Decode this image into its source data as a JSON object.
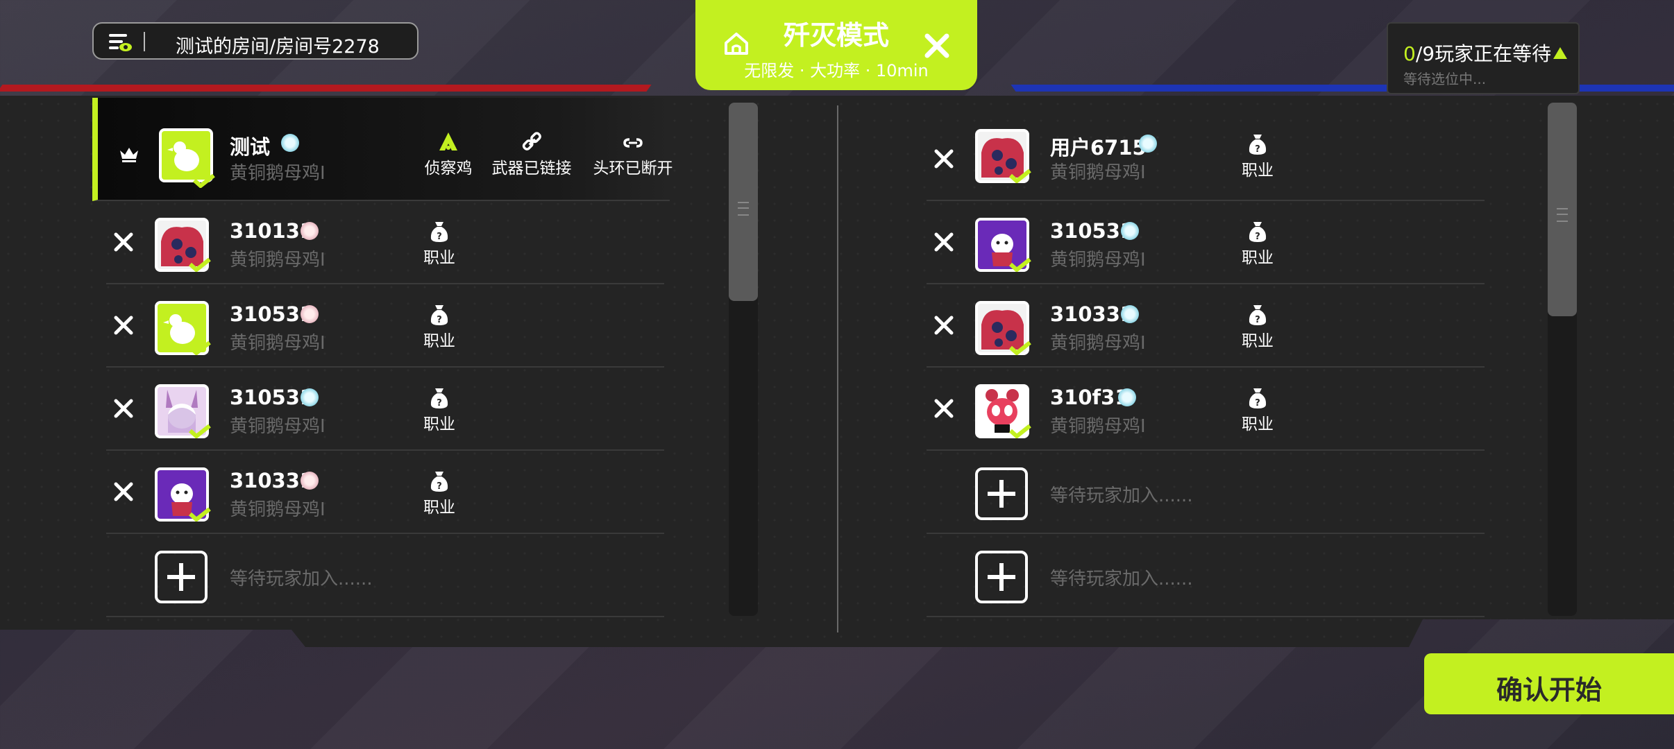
{
  "room": {
    "title": "测试的房间/房间号2278"
  },
  "mode": {
    "title": "歼灭模式",
    "subtitle": "无限发 · 大功率 · 10min"
  },
  "waiting": {
    "count": "0",
    "rest": "/9玩家正在等待",
    "sub": "等待选位中..."
  },
  "role_label": "职业",
  "empty_slot_text": "等待玩家加入......",
  "red_team": {
    "host": {
      "name": "测试",
      "subname": "黄铜鹅母鸡I",
      "role": "侦察鸡",
      "weapon": "武器已链接",
      "headband": "头环已断开"
    },
    "players": [
      {
        "name": "310131",
        "subname": "黄铜鹅母鸡I"
      },
      {
        "name": "310531",
        "subname": "黄铜鹅母鸡I"
      },
      {
        "name": "310531",
        "subname": "黄铜鹅母鸡I"
      },
      {
        "name": "310331",
        "subname": "黄铜鹅母鸡I"
      }
    ]
  },
  "blue_team": {
    "players": [
      {
        "name": "用户6715",
        "subname": "黄铜鹅母鸡I"
      },
      {
        "name": "310531",
        "subname": "黄铜鹅母鸡I"
      },
      {
        "name": "310331",
        "subname": "黄铜鹅母鸡I"
      },
      {
        "name": "310f31",
        "subname": "黄铜鹅母鸡I"
      }
    ]
  },
  "confirm": {
    "label": "确认开始"
  },
  "colors": {
    "accent": "#c3f020",
    "red_team": "#b3191f",
    "blue_team": "#1d34b5"
  }
}
